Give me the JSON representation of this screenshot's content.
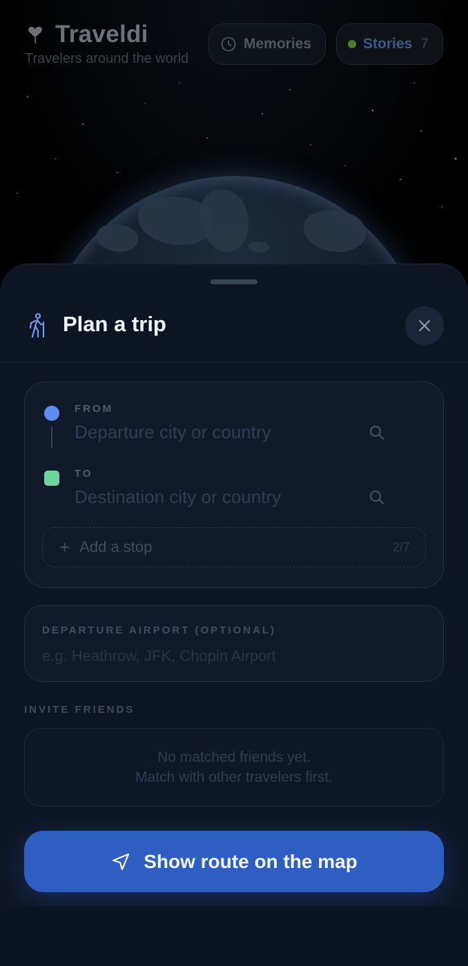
{
  "header": {
    "app_title": "Traveldi",
    "subtitle": "Travelers around the world",
    "memories_label": "Memories",
    "stories_label": "Stories",
    "stories_count": "7"
  },
  "sheet": {
    "title": "Plan a trip",
    "from": {
      "label": "FROM",
      "placeholder": "Departure city or country"
    },
    "to": {
      "label": "TO",
      "placeholder": "Destination city or country"
    },
    "add_stop": {
      "label": "Add a stop",
      "count": "2/7"
    },
    "airport": {
      "label": "DEPARTURE AIRPORT (OPTIONAL)",
      "placeholder": "e.g. Heathrow, JFK, Chopin Airport"
    },
    "invite": {
      "label": "INVITE FRIENDS",
      "empty_line1": "No matched friends yet.",
      "empty_line2": "Match with other travelers first."
    },
    "route_button": "Show route on the map"
  },
  "colors": {
    "accent": "#2f5ec3",
    "from_marker": "#5b8ef0",
    "to_marker": "#6fd39b",
    "sheet_bg": "#0e1522"
  }
}
